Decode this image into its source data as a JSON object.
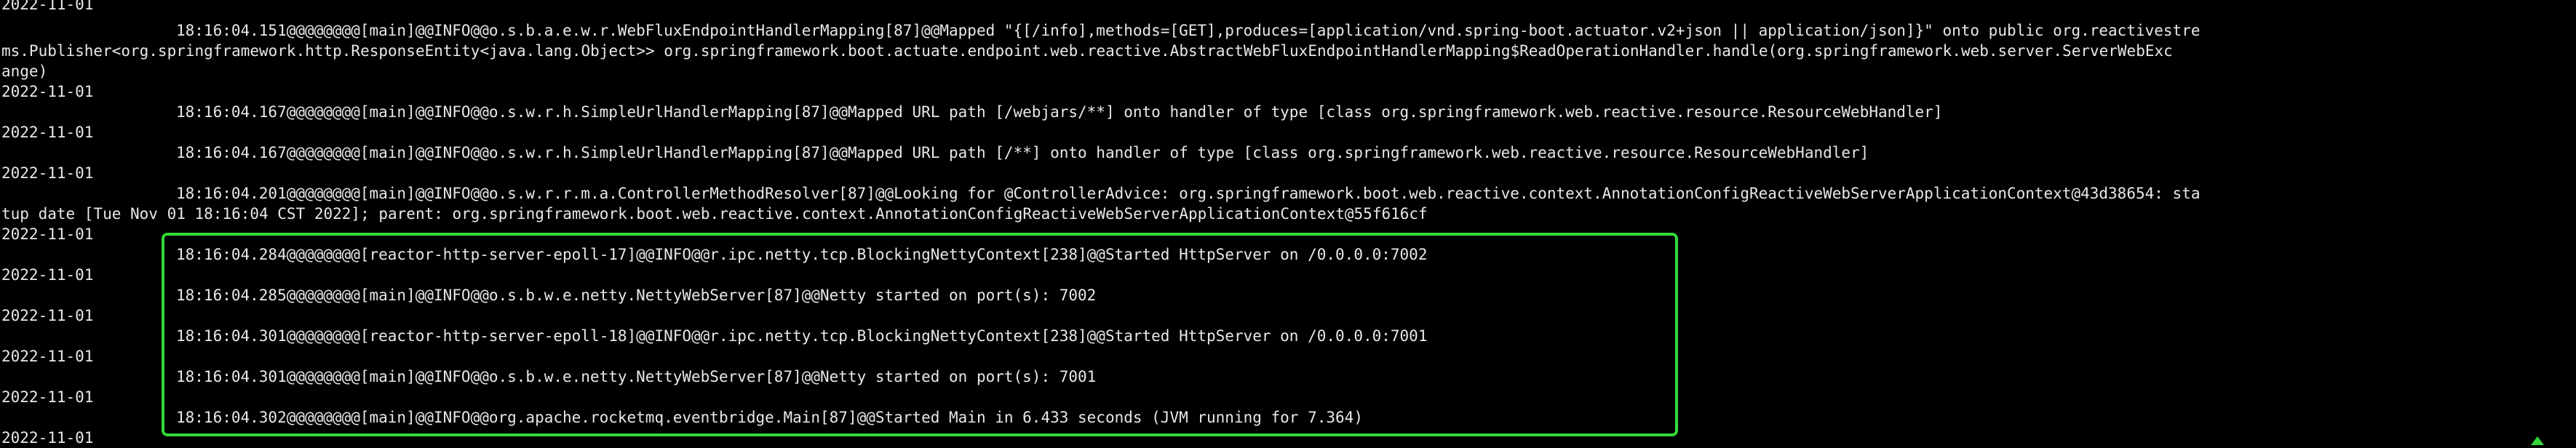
{
  "terminal": {
    "lines": [
      {
        "kind": "date",
        "text": "2022-11-01"
      },
      {
        "kind": "entry",
        "text": "18:16:04.151@@@@@@@@[main]@@INFO@@o.s.b.a.e.w.r.WebFluxEndpointHandlerMapping[87]@@Mapped \"{[/info],methods=[GET],produces=[application/vnd.spring-boot.actuator.v2+json || application/json]}\" onto public org.reactivestre"
      },
      {
        "kind": "wrap",
        "text": "ms.Publisher<org.springframework.http.ResponseEntity<java.lang.Object>> org.springframework.boot.actuate.endpoint.web.reactive.AbstractWebFluxEndpointHandlerMapping$ReadOperationHandler.handle(org.springframework.web.server.ServerWebExc"
      },
      {
        "kind": "wrap",
        "text": "ange)"
      },
      {
        "kind": "date",
        "text": "2022-11-01"
      },
      {
        "kind": "entry",
        "text": "18:16:04.167@@@@@@@@[main]@@INFO@@o.s.w.r.h.SimpleUrlHandlerMapping[87]@@Mapped URL path [/webjars/**] onto handler of type [class org.springframework.web.reactive.resource.ResourceWebHandler]"
      },
      {
        "kind": "date",
        "text": "2022-11-01"
      },
      {
        "kind": "entry",
        "text": "18:16:04.167@@@@@@@@[main]@@INFO@@o.s.w.r.h.SimpleUrlHandlerMapping[87]@@Mapped URL path [/**] onto handler of type [class org.springframework.web.reactive.resource.ResourceWebHandler]"
      },
      {
        "kind": "date",
        "text": "2022-11-01"
      },
      {
        "kind": "entry",
        "text": "18:16:04.201@@@@@@@@[main]@@INFO@@o.s.w.r.r.m.a.ControllerMethodResolver[87]@@Looking for @ControllerAdvice: org.springframework.boot.web.reactive.context.AnnotationConfigReactiveWebServerApplicationContext@43d38654: sta"
      },
      {
        "kind": "wrap",
        "text": "tup date [Tue Nov 01 18:16:04 CST 2022]; parent: org.springframework.boot.web.reactive.context.AnnotationConfigReactiveWebServerApplicationContext@55f616cf"
      },
      {
        "kind": "date",
        "text": "2022-11-01"
      },
      {
        "kind": "entry",
        "text": "18:16:04.284@@@@@@@@[reactor-http-server-epoll-17]@@INFO@@r.ipc.netty.tcp.BlockingNettyContext[238]@@Started HttpServer on /0.0.0.0:7002"
      },
      {
        "kind": "date",
        "text": "2022-11-01"
      },
      {
        "kind": "entry",
        "text": "18:16:04.285@@@@@@@@[main]@@INFO@@o.s.b.w.e.netty.NettyWebServer[87]@@Netty started on port(s): 7002"
      },
      {
        "kind": "date",
        "text": "2022-11-01"
      },
      {
        "kind": "entry",
        "text": "18:16:04.301@@@@@@@@[reactor-http-server-epoll-18]@@INFO@@r.ipc.netty.tcp.BlockingNettyContext[238]@@Started HttpServer on /0.0.0.0:7001"
      },
      {
        "kind": "date",
        "text": "2022-11-01"
      },
      {
        "kind": "entry",
        "text": "18:16:04.301@@@@@@@@[main]@@INFO@@o.s.b.w.e.netty.NettyWebServer[87]@@Netty started on port(s): 7001"
      },
      {
        "kind": "date",
        "text": "2022-11-01"
      },
      {
        "kind": "entry",
        "text": "18:16:04.302@@@@@@@@[main]@@INFO@@org.apache.rocketmq.eventbridge.Main[87]@@Started Main in 6.433 seconds (JVM running for 7.364)"
      },
      {
        "kind": "date",
        "text": "2022-11-01"
      }
    ]
  },
  "colors": {
    "background": "#000000",
    "text": "#e8e8e8",
    "highlight": "#33d93a"
  },
  "icons": {
    "caret": "caret-up-icon"
  }
}
